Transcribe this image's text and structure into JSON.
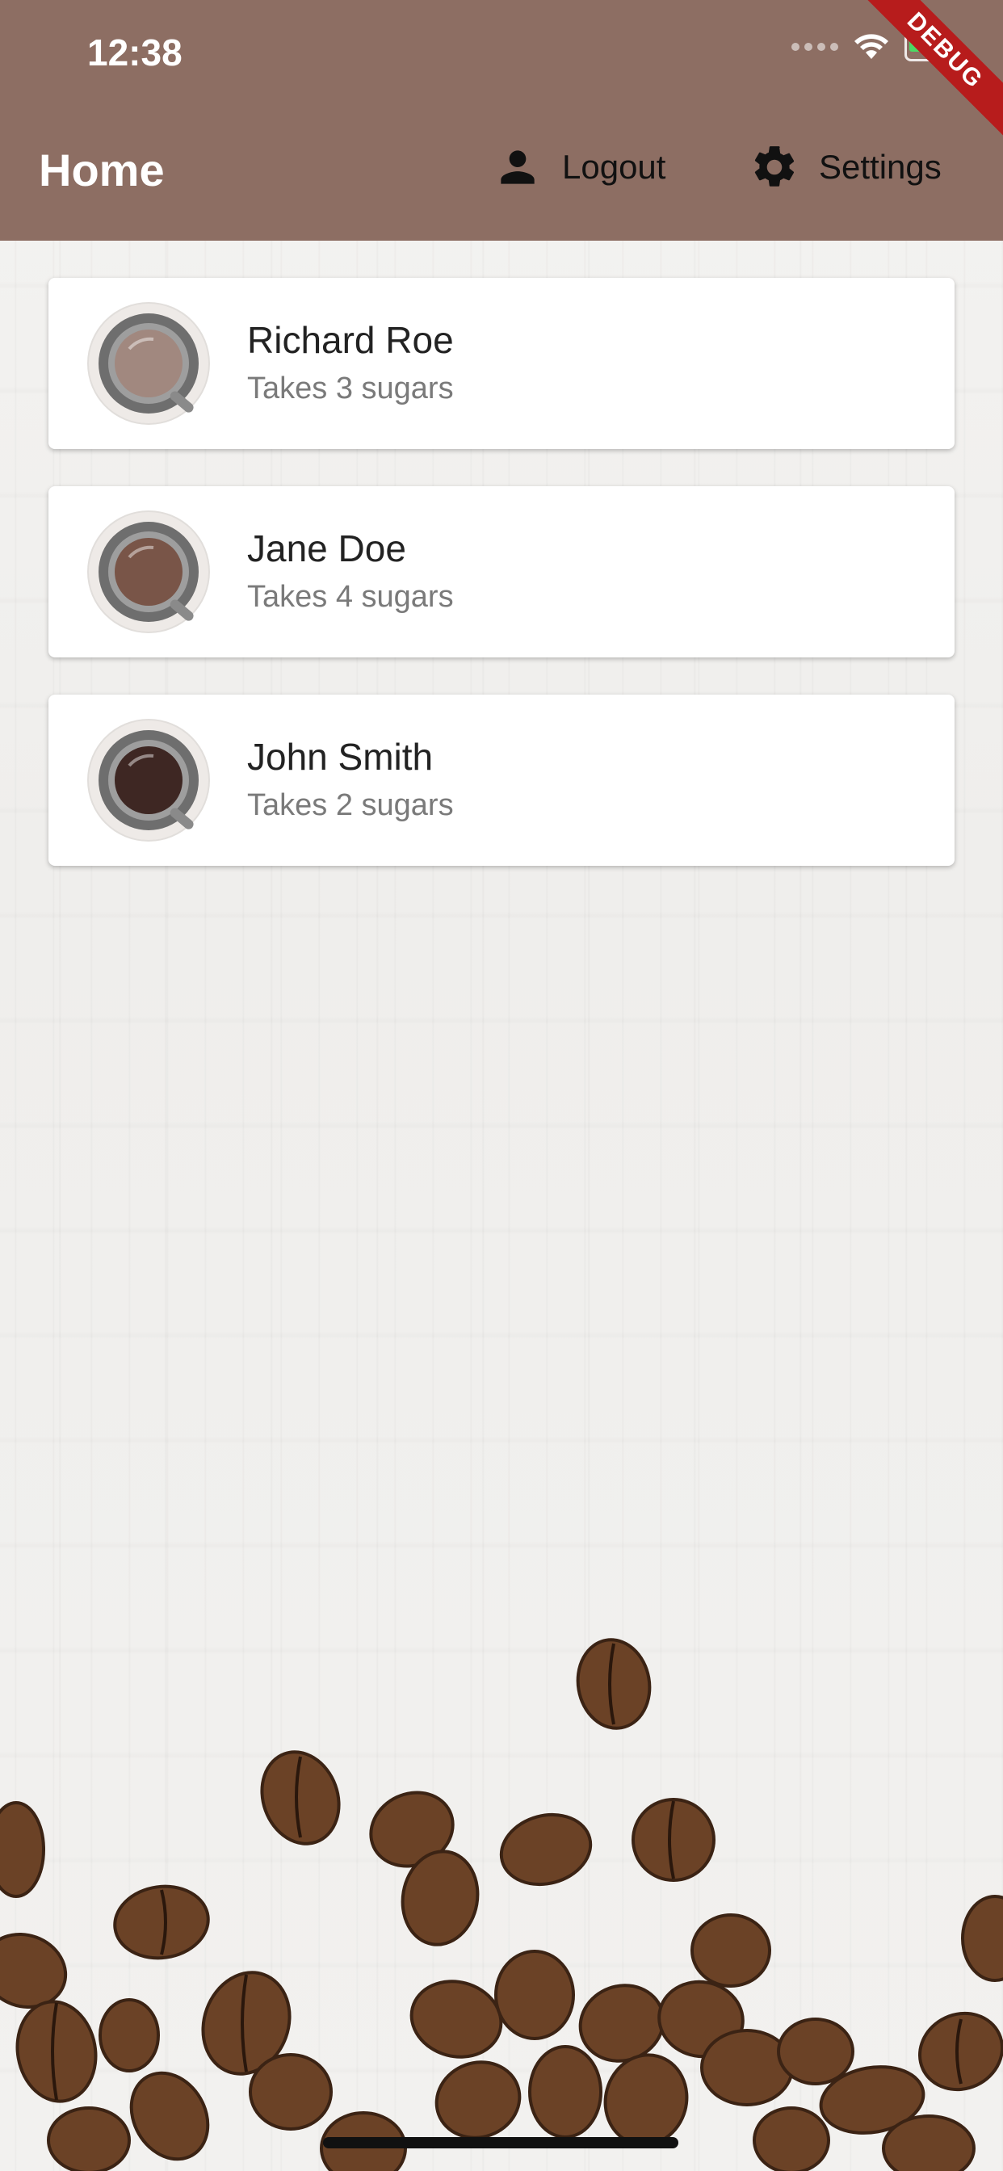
{
  "status": {
    "time": "12:38"
  },
  "debug_banner": {
    "label": "DEBUG"
  },
  "app_bar": {
    "title": "Home",
    "actions": [
      {
        "label": "Logout",
        "icon": "person-icon"
      },
      {
        "label": "Settings",
        "icon": "gear-icon"
      }
    ]
  },
  "brews": [
    {
      "name": "Richard Roe",
      "subtitle": "Takes 3 sugars",
      "coffee_color": "#a1887f"
    },
    {
      "name": "Jane Doe",
      "subtitle": "Takes 4 sugars",
      "coffee_color": "#795548"
    },
    {
      "name": "John Smith",
      "subtitle": "Takes 2 sugars",
      "coffee_color": "#3e2723"
    }
  ],
  "colors": {
    "app_bar": "#8d6e63",
    "accent_debug": "#b71c1c"
  }
}
